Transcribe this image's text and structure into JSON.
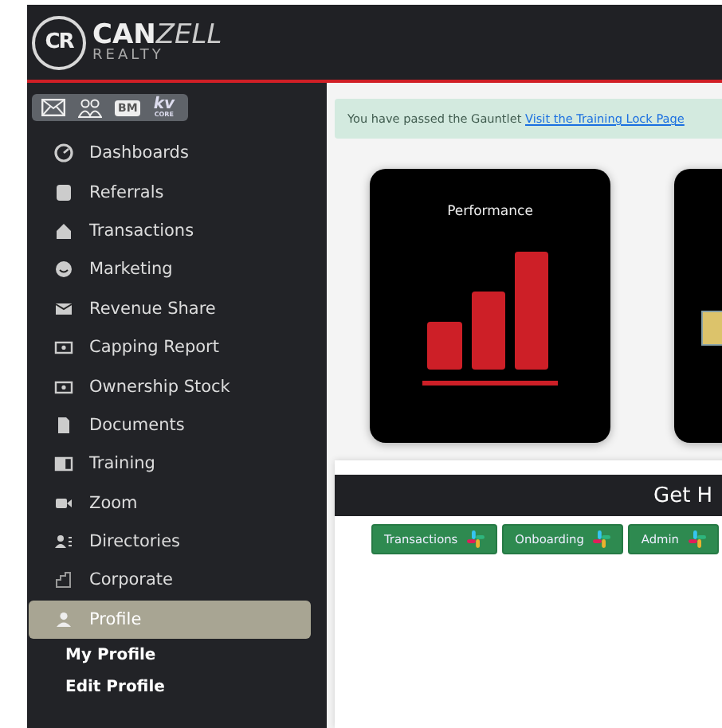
{
  "header": {
    "logo": {
      "mark": "CR",
      "name": "CAN",
      "name_rest": "ZELL",
      "sub": "REALTY"
    }
  },
  "sidebar": {
    "shortcuts": [
      {
        "kind": "mail"
      },
      {
        "kind": "people"
      },
      {
        "kind": "badge",
        "label": "BM"
      },
      {
        "kind": "kv",
        "label": "kv",
        "sub": "CORE"
      }
    ],
    "items": [
      {
        "label": "Dashboards",
        "selected": false
      },
      {
        "label": "Referrals",
        "selected": false
      },
      {
        "label": "Transactions",
        "selected": false
      },
      {
        "label": "Marketing",
        "selected": false
      },
      {
        "label": "Revenue Share",
        "selected": false
      },
      {
        "label": "Capping Report",
        "selected": false
      },
      {
        "label": "Ownership Stock",
        "selected": false
      },
      {
        "label": "Documents",
        "selected": false
      },
      {
        "label": "Training",
        "selected": false
      },
      {
        "label": "Zoom",
        "selected": false
      },
      {
        "label": "Directories",
        "selected": false
      },
      {
        "label": "Corporate",
        "selected": false
      },
      {
        "label": "Profile",
        "selected": true,
        "children": [
          {
            "label": "My Profile"
          },
          {
            "label": "Edit Profile"
          }
        ]
      }
    ]
  },
  "alert": {
    "text": "You have passed the Gauntlet",
    "link": "Visit the Training Lock Page"
  },
  "cards": [
    {
      "kind": "chart",
      "title": "Performance"
    },
    {
      "kind": "tile"
    }
  ],
  "help": {
    "title": "Get H",
    "buttons": [
      {
        "label": "Transactions"
      },
      {
        "label": "Onboarding"
      },
      {
        "label": "Admin"
      }
    ]
  }
}
